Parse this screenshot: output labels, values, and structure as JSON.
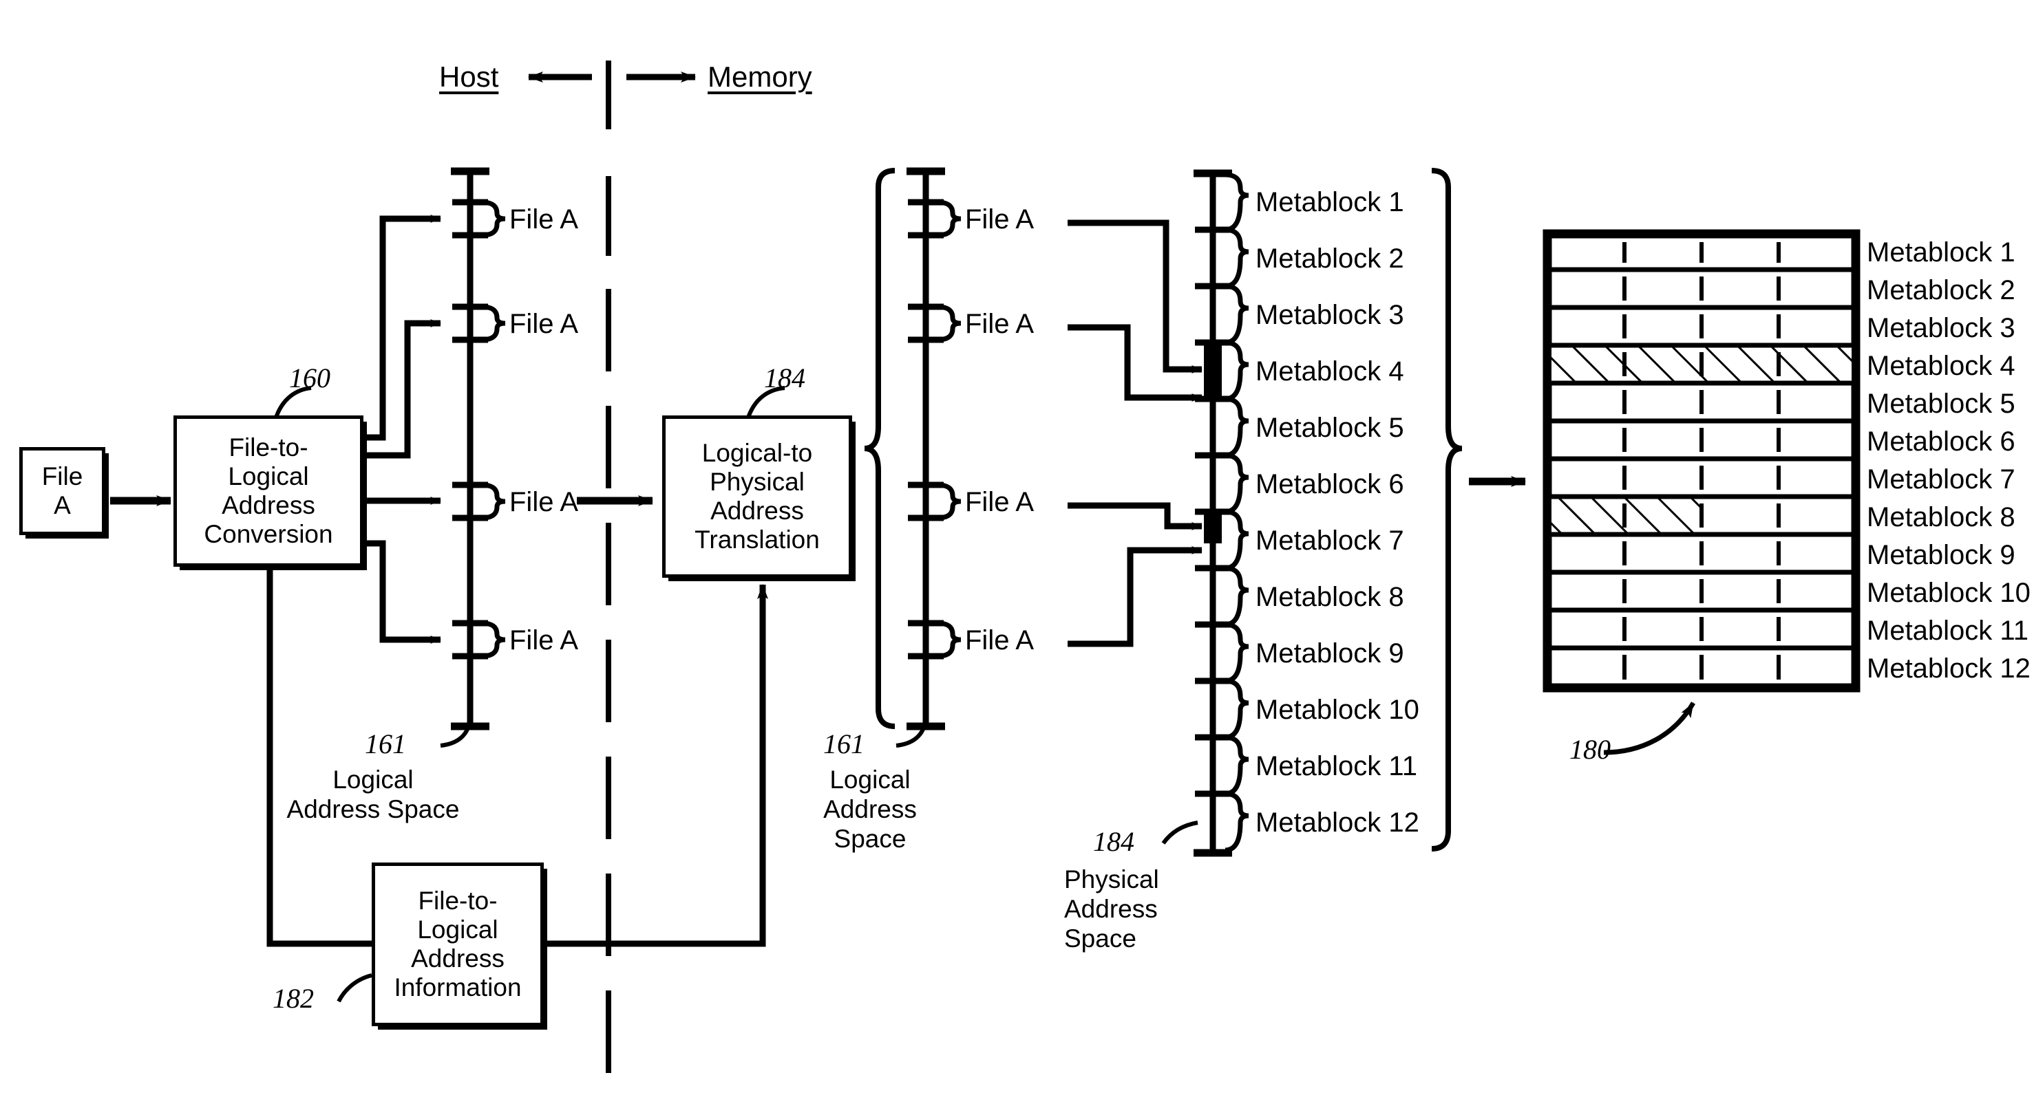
{
  "figure": {
    "title_host": "Host",
    "title_memory": "Memory"
  },
  "host": {
    "file_box": "File\nA",
    "file_box_line1": "File",
    "file_box_line2": "A",
    "conversion_box": "File-to-\nLogical\nAddress\nConversion",
    "conversion_ref": "160",
    "info_box": "File-to-\nLogical\nAddress\nInformation",
    "info_ref": "182",
    "logical_axis_ref": "161",
    "logical_axis_caption": "Logical\nAddress Space",
    "file_segments": [
      "File A",
      "File A",
      "File A",
      "File A"
    ]
  },
  "memory": {
    "translation_box": "Logical-to\nPhysical\nAddress\nTranslation",
    "translation_ref": "184",
    "logical_axis_ref": "161",
    "logical_axis_caption": "Logical\nAddress\nSpace",
    "file_segments": [
      "File A",
      "File A",
      "File A",
      "File A"
    ],
    "physical_axis_ref": "184",
    "physical_axis_caption": "Physical\nAddress\nSpace",
    "metablocks": [
      "Metablock 1",
      "Metablock 2",
      "Metablock 3",
      "Metablock 4",
      "Metablock 5",
      "Metablock 6",
      "Metablock 7",
      "Metablock 8",
      "Metablock 9",
      "Metablock 10",
      "Metablock 11",
      "Metablock 12"
    ]
  },
  "memory_array": {
    "ref": "180",
    "rows": [
      "Metablock 1",
      "Metablock 2",
      "Metablock 3",
      "Metablock 4",
      "Metablock 5",
      "Metablock 6",
      "Metablock 7",
      "Metablock 8",
      "Metablock 9",
      "Metablock 10",
      "Metablock 11",
      "Metablock 12"
    ],
    "columns": 4,
    "hatched": [
      {
        "row": 4,
        "cells": [
          1,
          2,
          3,
          4
        ]
      },
      {
        "row": 7,
        "cells": [
          1,
          2
        ]
      }
    ]
  },
  "colors": {
    "ink": "#000000",
    "paper": "#ffffff"
  }
}
